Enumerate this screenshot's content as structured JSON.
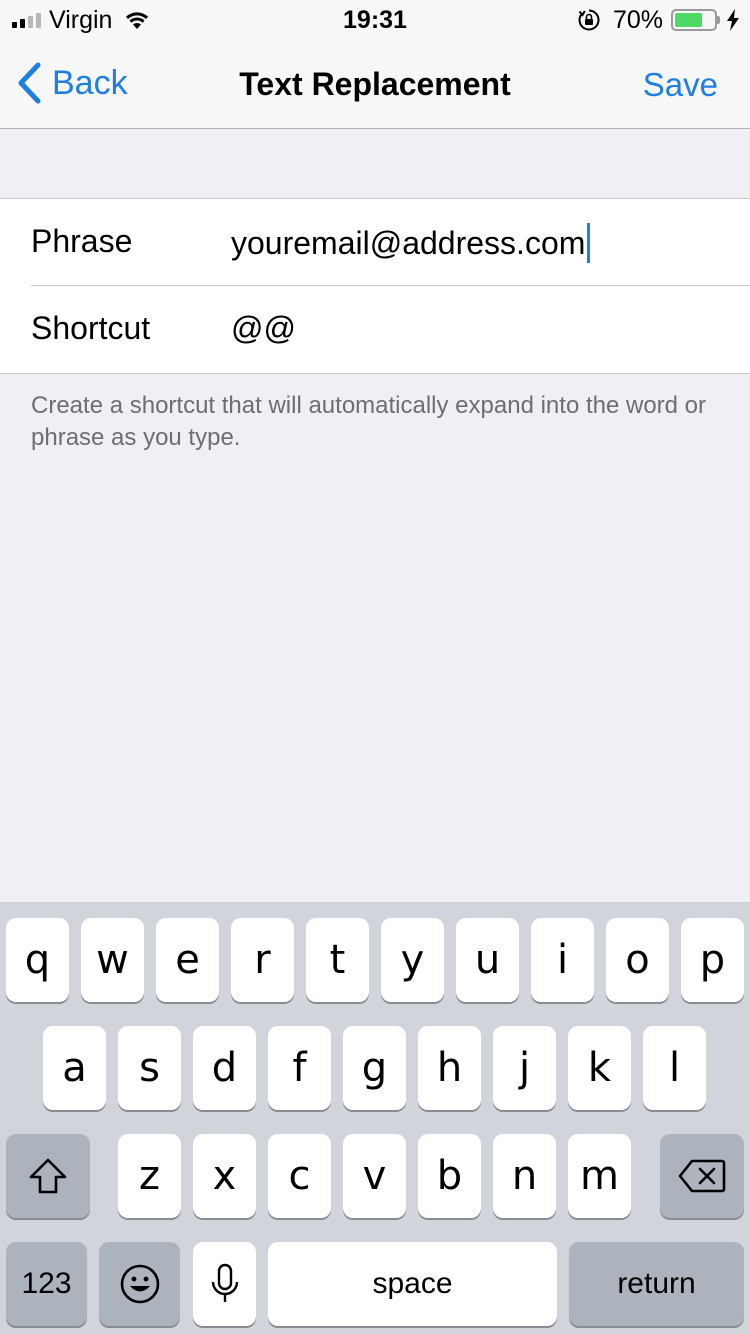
{
  "status_bar": {
    "carrier": "Virgin",
    "time": "19:31",
    "battery_percent_label": "70%",
    "battery_level": 0.7,
    "signal_bars_filled": 2,
    "signal_bars_total": 4,
    "icons": [
      "signal-icon",
      "wifi-icon",
      "orientation-lock-icon",
      "battery-icon",
      "charging-bolt-icon"
    ]
  },
  "nav": {
    "back_label": "Back",
    "title": "Text Replacement",
    "save_label": "Save"
  },
  "form": {
    "phrase_label": "Phrase",
    "phrase_value": "youremail@address.com",
    "shortcut_label": "Shortcut",
    "shortcut_value": "@@",
    "footer_note": "Create a shortcut that will automatically expand into the word or phrase as you type."
  },
  "keyboard": {
    "row1": [
      "q",
      "w",
      "e",
      "r",
      "t",
      "y",
      "u",
      "i",
      "o",
      "p"
    ],
    "row2": [
      "a",
      "s",
      "d",
      "f",
      "g",
      "h",
      "j",
      "k",
      "l"
    ],
    "row3": [
      "z",
      "x",
      "c",
      "v",
      "b",
      "n",
      "m"
    ],
    "numbers_label": "123",
    "space_label": "space",
    "return_label": "return",
    "icons": [
      "shift-icon",
      "delete-icon",
      "emoji-icon",
      "microphone-icon"
    ]
  },
  "colors": {
    "accent": "#1e7ee2",
    "background": "#efeff4",
    "keyboard_bg": "#d1d5db",
    "battery_fill": "#4cd964"
  }
}
